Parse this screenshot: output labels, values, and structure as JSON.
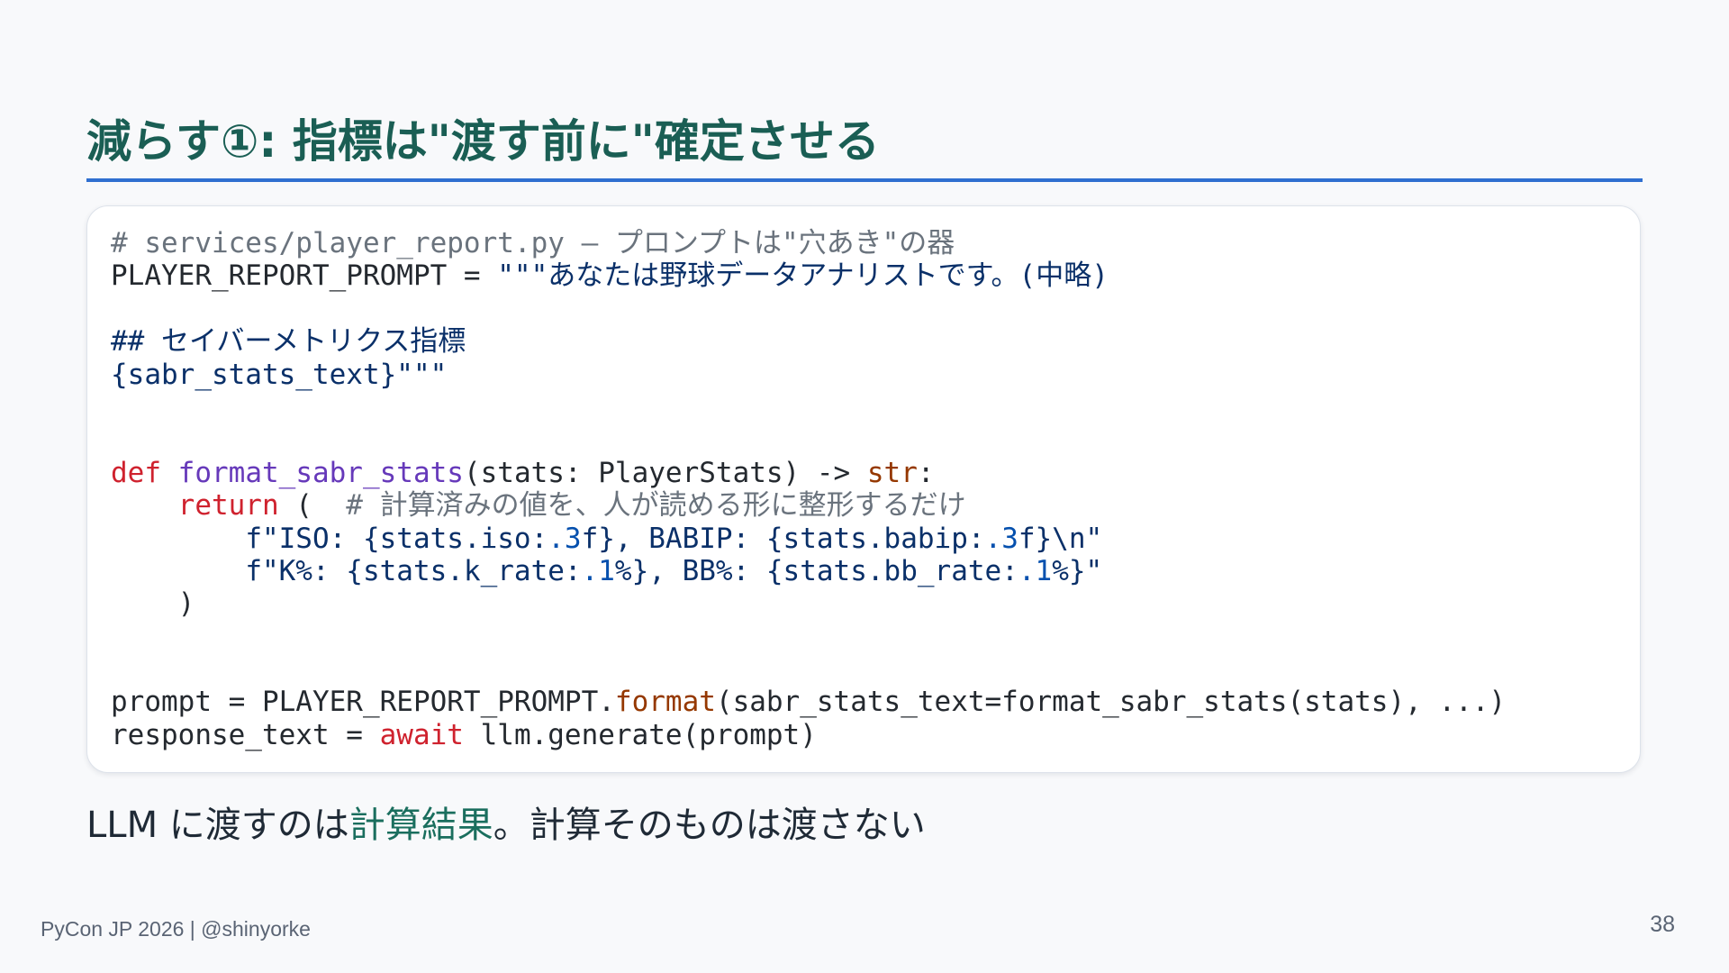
{
  "slide": {
    "title": "減らす①: 指標は\"渡す前に\"確定させる",
    "caption_prefix": "LLM に渡すのは",
    "caption_highlight": "計算結果",
    "caption_suffix": "。計算そのものは渡さない",
    "footer": "PyCon JP 2026 | @shinyorke",
    "page_number": "38"
  },
  "code": {
    "l1_comment": "# services/player_report.py — プロンプトは\"穴あき\"の器",
    "l2_name": "PLAYER_REPORT_PROMPT = ",
    "l2_string": "\"\"\"あなたは野球データアナリストです。(中略)",
    "l4_string": "## セイバーメトリクス指標",
    "l5_string": "{sabr_stats_text}\"\"\"",
    "l8_def": "def",
    "l8_fn": "format_sabr_stats",
    "l8_params": "(stats: PlayerStats) -> ",
    "l8_type": "str",
    "l8_colon": ":",
    "l9_indent": "    ",
    "l9_return": "return",
    "l9_paren": " (  ",
    "l9_comment": "# 計算済みの値を、人が読める形に整形するだけ",
    "l10_indent": "        ",
    "l10_a": "f\"ISO: {stats.iso:",
    "l10_b": ".3",
    "l10_c": "f}, BABIP: {stats.babip:",
    "l10_d": ".3",
    "l10_e": "f}\\n\"",
    "l11_indent": "        ",
    "l11_a": "f\"K%: {stats.k_rate:",
    "l11_b": ".1",
    "l11_c": "%}, BB%: {stats.bb_rate:",
    "l11_d": ".1",
    "l11_e": "%}\"",
    "l12_close": "    )",
    "l15_a": "prompt = PLAYER_REPORT_PROMPT.",
    "l15_method": "format",
    "l15_b": "(sabr_stats_text=format_sabr_stats(stats), ...)",
    "l16_a": "response_text = ",
    "l16_await": "await",
    "l16_b": " llm.generate(prompt)"
  },
  "colors": {
    "title": "#1a5e54",
    "rule": "#2f6fd0",
    "highlight": "#1a6e5e",
    "keyword": "#cf222e",
    "function": "#6639ba",
    "builtin": "#953800",
    "string": "#0a3069",
    "number": "#0550ae",
    "comment": "#6a737d"
  }
}
